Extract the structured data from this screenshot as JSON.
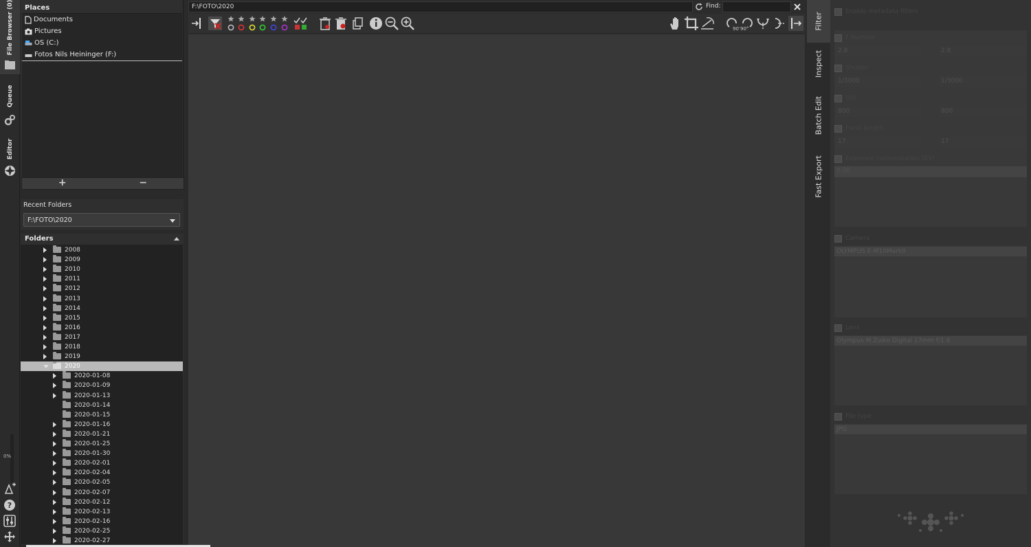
{
  "left_tabs": {
    "file_browser": "File Browser (0)",
    "queue": "Queue",
    "editor": "Editor",
    "progress": "0%"
  },
  "places": {
    "title": "Places",
    "items": [
      {
        "label": "Documents",
        "icon": "document-icon"
      },
      {
        "label": "Pictures",
        "icon": "camera-icon"
      },
      {
        "label": "OS (C:)",
        "icon": "drive-icon"
      },
      {
        "label": "Fotos Nils Heininger (F:)",
        "icon": "drive-icon"
      }
    ],
    "add": "+",
    "remove": "−"
  },
  "recent": {
    "title": "Recent Folders",
    "value": "F:\\FOTO\\2020"
  },
  "folders": {
    "title": "Folders",
    "items": [
      {
        "label": "2008",
        "level": 0,
        "exp": "c"
      },
      {
        "label": "2009",
        "level": 0,
        "exp": "c"
      },
      {
        "label": "2010",
        "level": 0,
        "exp": "c"
      },
      {
        "label": "2011",
        "level": 0,
        "exp": "c"
      },
      {
        "label": "2012",
        "level": 0,
        "exp": "c"
      },
      {
        "label": "2013",
        "level": 0,
        "exp": "c"
      },
      {
        "label": "2014",
        "level": 0,
        "exp": "c"
      },
      {
        "label": "2015",
        "level": 0,
        "exp": "c"
      },
      {
        "label": "2016",
        "level": 0,
        "exp": "c"
      },
      {
        "label": "2017",
        "level": 0,
        "exp": "c"
      },
      {
        "label": "2018",
        "level": 0,
        "exp": "c"
      },
      {
        "label": "2019",
        "level": 0,
        "exp": "c"
      },
      {
        "label": "2020",
        "level": 0,
        "exp": "o",
        "selected": true
      },
      {
        "label": "2020-01-08",
        "level": 1,
        "exp": "c"
      },
      {
        "label": "2020-01-09",
        "level": 1,
        "exp": "c"
      },
      {
        "label": "2020-01-13",
        "level": 1,
        "exp": "c"
      },
      {
        "label": "2020-01-14",
        "level": 1,
        "exp": "n"
      },
      {
        "label": "2020-01-15",
        "level": 1,
        "exp": "n"
      },
      {
        "label": "2020-01-16",
        "level": 1,
        "exp": "c"
      },
      {
        "label": "2020-01-21",
        "level": 1,
        "exp": "c"
      },
      {
        "label": "2020-01-25",
        "level": 1,
        "exp": "c"
      },
      {
        "label": "2020-01-30",
        "level": 1,
        "exp": "c"
      },
      {
        "label": "2020-02-01",
        "level": 1,
        "exp": "c"
      },
      {
        "label": "2020-02-04",
        "level": 1,
        "exp": "c"
      },
      {
        "label": "2020-02-05",
        "level": 1,
        "exp": "c"
      },
      {
        "label": "2020-02-07",
        "level": 1,
        "exp": "c"
      },
      {
        "label": "2020-02-12",
        "level": 1,
        "exp": "c"
      },
      {
        "label": "2020-02-13",
        "level": 1,
        "exp": "c"
      },
      {
        "label": "2020-02-16",
        "level": 1,
        "exp": "c"
      },
      {
        "label": "2020-02-25",
        "level": 1,
        "exp": "c"
      },
      {
        "label": "2020-02-27",
        "level": 1,
        "exp": "c"
      }
    ]
  },
  "topbar": {
    "path": "F:\\FOTO\\2020",
    "find_label": "Find:",
    "find_value": ""
  },
  "right_tabs": [
    "Filter",
    "Inspect",
    "Batch Edit",
    "Fast Export"
  ],
  "filter": {
    "enable_label": "Enable metadata filters",
    "fnumber": {
      "label": "F Number",
      "from": "2.8",
      "to": "2.8"
    },
    "shutter": {
      "label": "Shutter",
      "from": "1/3000",
      "to": "1/3000"
    },
    "iso": {
      "label": "ISO",
      "from": "800",
      "to": "800"
    },
    "focal": {
      "label": "Focal length",
      "from": "17",
      "to": "17"
    },
    "expcomp": {
      "label": "Exposure compensation (EV)",
      "value": "0.00"
    },
    "camera": {
      "label": "Camera",
      "value": "OLYMPUS E-M10MarkII"
    },
    "lens": {
      "label": "Lens",
      "value": "Olympus M.Zuiko Digital 17mm f/1.8"
    },
    "filetype": {
      "label": "File type",
      "value": "JPG"
    }
  }
}
